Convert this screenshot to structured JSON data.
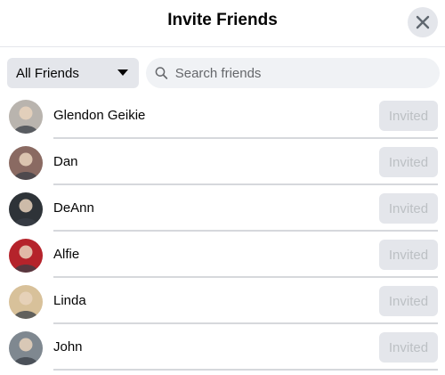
{
  "header": {
    "title": "Invite Friends",
    "close_icon": "close-icon"
  },
  "toolbar": {
    "filter_label": "All Friends",
    "filter_icon": "caret-down-icon",
    "search_placeholder": "Search friends",
    "search_value": "",
    "search_icon": "search-icon"
  },
  "friends": [
    {
      "name": "Glendon Geikie",
      "status": "Invited",
      "avatar_color": "#b9b4ae"
    },
    {
      "name": "Dan",
      "status": "Invited",
      "avatar_color": "#8a6a62"
    },
    {
      "name": "DeAnn",
      "status": "Invited",
      "avatar_color": "#2e3338"
    },
    {
      "name": "Alfie",
      "status": "Invited",
      "avatar_color": "#b5232b"
    },
    {
      "name": "Linda",
      "status": "Invited",
      "avatar_color": "#d8c19a"
    },
    {
      "name": "John",
      "status": "Invited",
      "avatar_color": "#7f8890"
    }
  ],
  "colors": {
    "button_bg": "#e4e6eb",
    "disabled_text": "#bcc0c4",
    "search_bg": "#f0f2f5"
  }
}
